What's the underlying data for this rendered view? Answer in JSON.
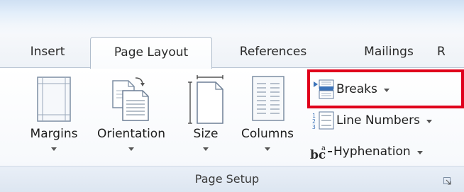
{
  "tabs": [
    {
      "label": "Insert"
    },
    {
      "label": "Page Layout",
      "active": true
    },
    {
      "label": "References"
    },
    {
      "label": "Mailings"
    },
    {
      "label": "R"
    }
  ],
  "page_setup": {
    "group_label": "Page Setup",
    "margins_label": "Margins",
    "orientation_label": "Orientation",
    "size_label": "Size",
    "columns_label": "Columns",
    "breaks_label": "Breaks",
    "line_numbers_label": "Line Numbers",
    "hyphenation_label": "Hyphenation",
    "hyphenation_glyph": "bc"
  },
  "icons": {
    "margins": "margins-icon",
    "orientation": "orientation-icon",
    "size": "size-icon",
    "columns": "columns-icon",
    "breaks": "breaks-icon",
    "line_numbers": "line-numbers-icon",
    "hyphenation": "hyphenation-icon",
    "dialog_launcher": "dialog-launcher-icon"
  },
  "colors": {
    "highlight": "#e0001b",
    "icon_blue": "#3b73b9",
    "tab_border": "#b0bdcc"
  }
}
